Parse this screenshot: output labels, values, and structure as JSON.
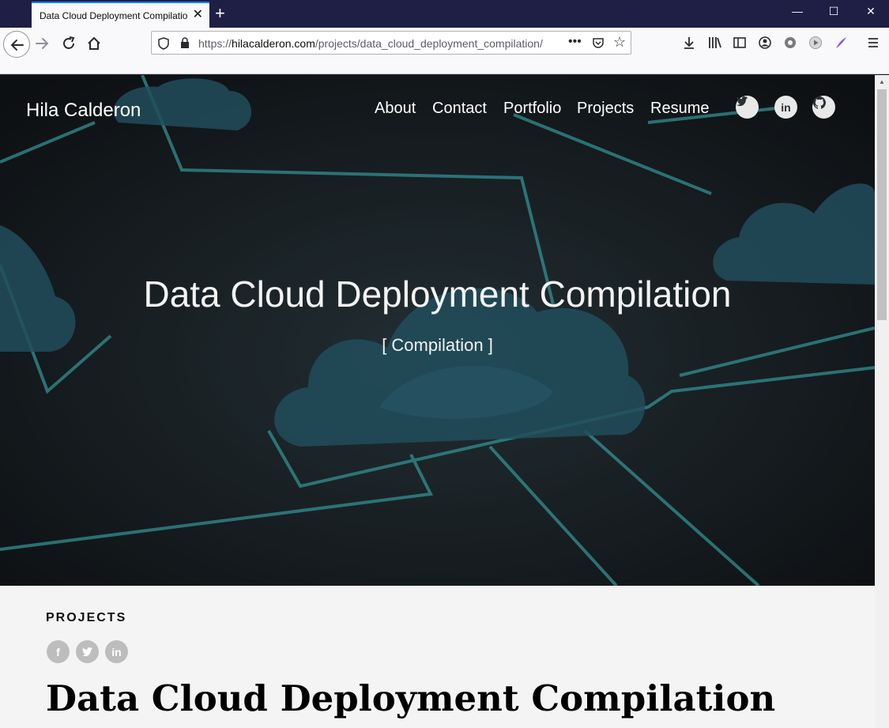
{
  "browser": {
    "tab_title": "Data Cloud Deployment Compilation",
    "url_prefix": "https://",
    "url_host": "hilacalderon.com",
    "url_path": "/projects/data_cloud_deployment_compilation/"
  },
  "site": {
    "brand": "Hila Calderon",
    "menu": [
      "About",
      "Contact",
      "Portfolio",
      "Projects",
      "Resume"
    ],
    "social": [
      "twitter-icon",
      "linkedin-icon",
      "github-icon"
    ]
  },
  "hero": {
    "title": "Data Cloud Deployment Compilation",
    "subtitle": "[ Compilation ]"
  },
  "content": {
    "section_label": "PROJECTS",
    "share_icons": [
      "facebook-icon",
      "twitter-icon",
      "linkedin-icon"
    ],
    "article_title": "Data Cloud Deployment Compilation"
  },
  "colors": {
    "titlebar": "#1f1e45",
    "accent": "#0a84ff",
    "hero_bg": "#1c252b",
    "cloud": "#2a6073",
    "circuit": "#3fb3b8"
  }
}
